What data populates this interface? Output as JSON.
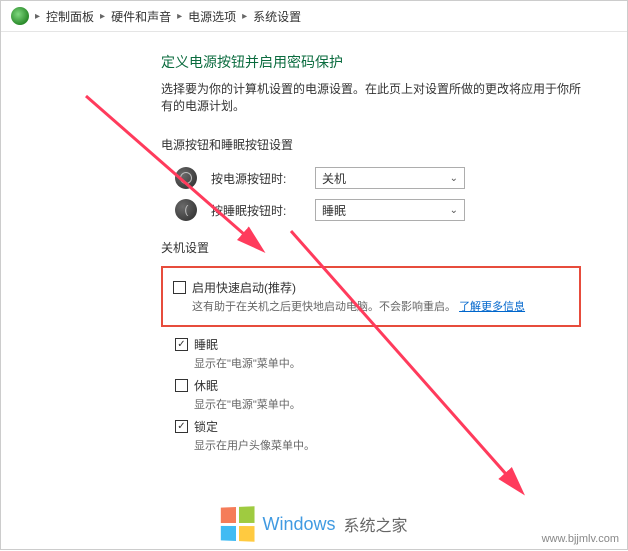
{
  "breadcrumb": {
    "items": [
      "控制面板",
      "硬件和声音",
      "电源选项",
      "系统设置"
    ]
  },
  "header": {
    "title": "定义电源按钮并启用密码保护",
    "subtitle": "选择要为你的计算机设置的电源设置。在此页上对设置所做的更改将应用于你所有的电源计划。"
  },
  "section1": {
    "label": "电源按钮和睡眠按钮设置",
    "row1": {
      "label": "按电源按钮时:",
      "value": "关机"
    },
    "row2": {
      "label": "按睡眠按钮时:",
      "value": "睡眠"
    }
  },
  "section2": {
    "label": "关机设置",
    "fast_startup": {
      "label": "启用快速启动(推荐)",
      "desc_prefix": "这有助于在关机之后更快地启动电脑。不会影响重启。",
      "link": "了解更多信息"
    },
    "sleep_option": {
      "label": "睡眠",
      "desc": "显示在\"电源\"菜单中。"
    },
    "hibernate": {
      "label": "休眠",
      "desc": "显示在\"电源\"菜单中。"
    },
    "lock": {
      "label": "锁定",
      "desc": "显示在用户头像菜单中。"
    }
  },
  "watermark": {
    "text1": "Windows",
    "text2": "系统之家",
    "url": "www.bjjmlv.com"
  },
  "colors": {
    "highlight": "#e74c3c",
    "title": "#0a6b3e",
    "link": "#0066cc"
  }
}
